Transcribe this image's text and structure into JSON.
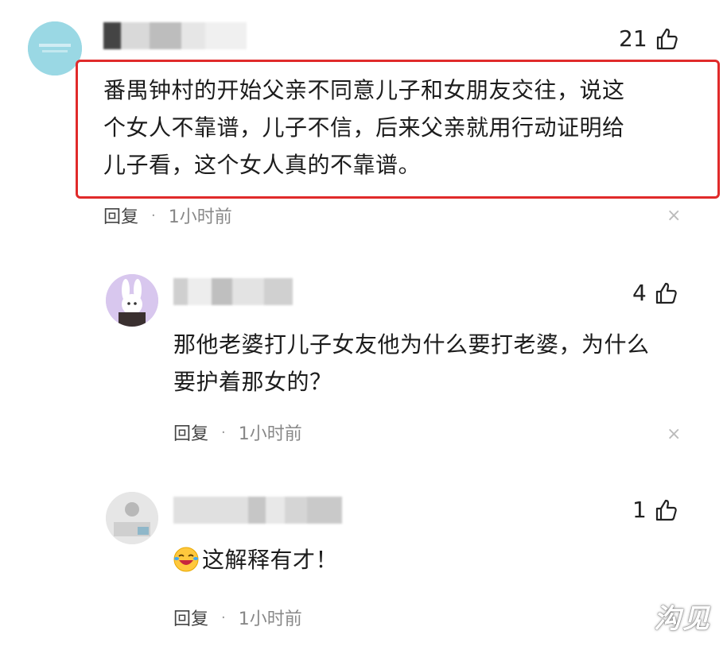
{
  "comments": [
    {
      "username_partial": "二 左顾面por",
      "likes": "21",
      "text_lines": [
        "番禺钟村的开始父亲不同意儿子和女朋友交往，说这",
        "个女人不靠谱，儿子不信，后来父亲就用行动证明给",
        "儿子看，这个女人真的不靠谱。"
      ],
      "reply_label": "回复",
      "time": "1小时前",
      "dot": "·",
      "close": "×"
    },
    {
      "likes": "4",
      "text_lines": [
        "那他老婆打儿子女友他为什么要打老婆，为什么",
        "要护着那女的？"
      ],
      "reply_label": "回复",
      "time": "1小时前",
      "dot": "·",
      "close": "×"
    },
    {
      "likes": "1",
      "text": "这解释有才！",
      "emoji": "laughing-crying-emoji",
      "reply_label": "回复",
      "time": "1小时前",
      "dot": "·"
    }
  ],
  "watermark": "沟见",
  "colors": {
    "highlight": "#e02a2a",
    "text": "#1c1c1c",
    "meta": "#888888"
  }
}
